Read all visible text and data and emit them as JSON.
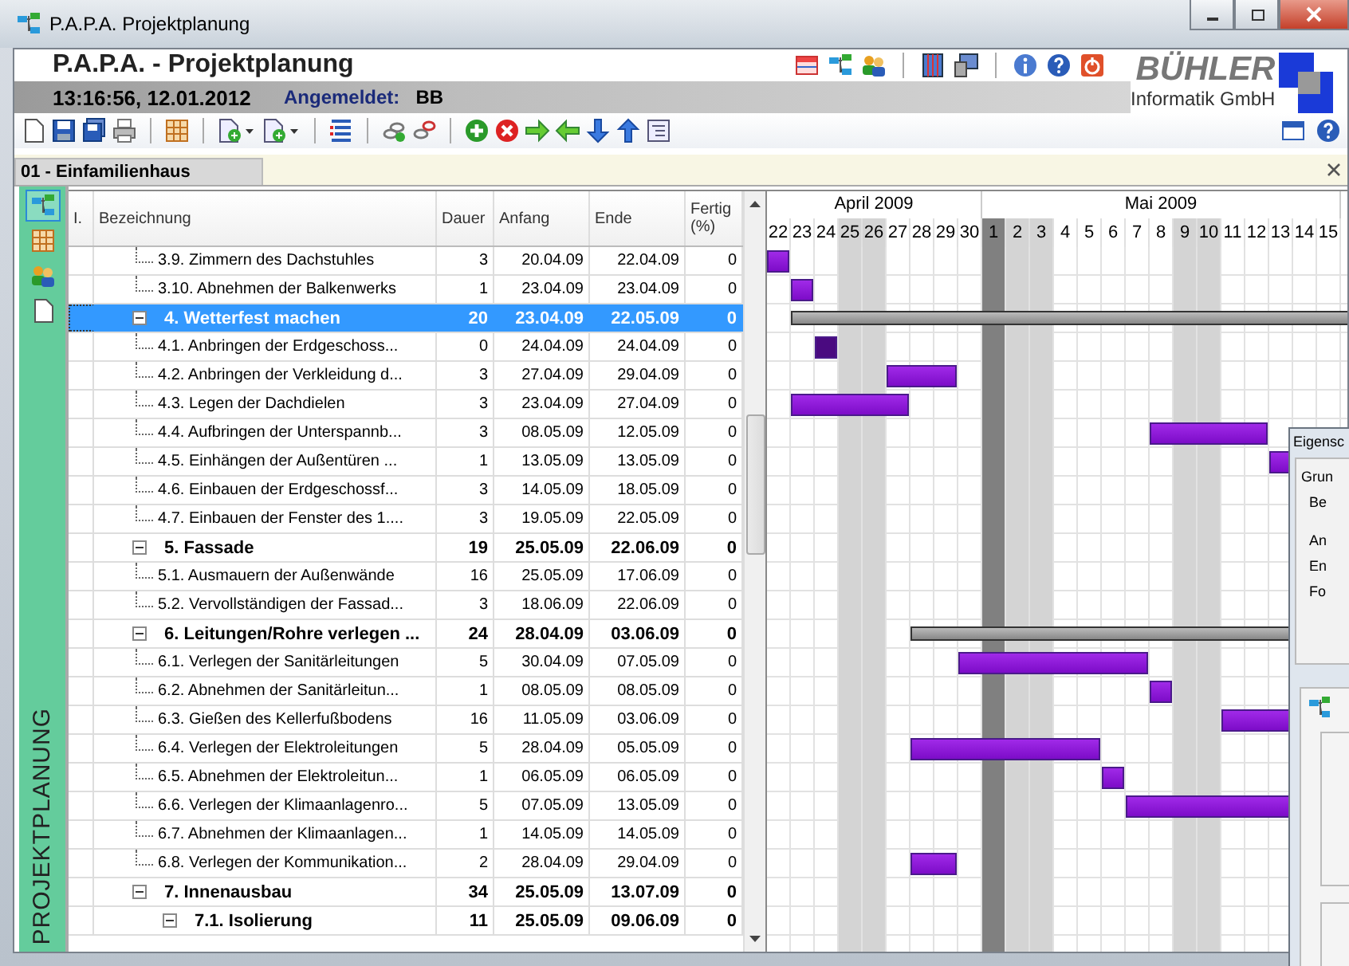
{
  "window": {
    "title": "P.A.P.A. Projektplanung"
  },
  "header": {
    "title": "P.A.P.A. - Projektplanung",
    "time": "13:16:56, 12.01.2012",
    "user_label": "Angemeldet:",
    "user": "BB",
    "logo_name": "BÜHLER",
    "logo_company": "Informatik GmbH"
  },
  "document_tab": {
    "label": "01 - Einfamilienhaus",
    "selected": true
  },
  "sidebar": {
    "label": "PROJEKTPLANUNG",
    "items": [
      {
        "kind": "tree",
        "selected": true
      },
      {
        "kind": "table",
        "selected": false
      },
      {
        "kind": "people",
        "selected": false
      },
      {
        "kind": "page",
        "selected": false
      }
    ]
  },
  "table": {
    "columns": [
      "I.",
      "Bezeichnung",
      "Dauer",
      "Anfang",
      "Ende",
      "Fertig (%)"
    ],
    "rows": [
      {
        "kind": "continued",
        "children": [
          {
            "name": "3.9. Zimmern des Dachstuhles",
            "duration": "3",
            "start": "20.04.09",
            "end": "22.04.09",
            "done": "0",
            "selected": false
          },
          {
            "name": "3.10. Abnehmen der Balkenwerks",
            "duration": "1",
            "start": "23.04.09",
            "end": "23.04.09",
            "done": "0",
            "selected": false
          }
        ]
      },
      {
        "name": "4. Wetterfest machen",
        "duration": "20",
        "start": "23.04.09",
        "end": "22.05.09",
        "done": "0",
        "selected": true,
        "expanded": true,
        "children": [
          {
            "name": "4.1. Anbringen der Erdgeschoss...",
            "duration": "0",
            "start": "24.04.09",
            "end": "24.04.09",
            "done": "0",
            "selected": false
          },
          {
            "name": "4.2. Anbringen der Verkleidung d...",
            "duration": "3",
            "start": "27.04.09",
            "end": "29.04.09",
            "done": "0",
            "selected": false
          },
          {
            "name": "4.3. Legen der Dachdielen",
            "duration": "3",
            "start": "23.04.09",
            "end": "27.04.09",
            "done": "0",
            "selected": false
          },
          {
            "name": "4.4. Aufbringen der Unterspannb...",
            "duration": "3",
            "start": "08.05.09",
            "end": "12.05.09",
            "done": "0",
            "selected": false
          },
          {
            "name": "4.5. Einhängen der Außentüren ...",
            "duration": "1",
            "start": "13.05.09",
            "end": "13.05.09",
            "done": "0",
            "selected": false
          },
          {
            "name": "4.6. Einbauen der Erdgeschossf...",
            "duration": "3",
            "start": "14.05.09",
            "end": "18.05.09",
            "done": "0",
            "selected": false
          },
          {
            "name": "4.7. Einbauen der Fenster des 1....",
            "duration": "3",
            "start": "19.05.09",
            "end": "22.05.09",
            "done": "0",
            "selected": false
          }
        ]
      },
      {
        "name": "5. Fassade",
        "duration": "19",
        "start": "25.05.09",
        "end": "22.06.09",
        "done": "0",
        "selected": false,
        "expanded": true,
        "children": [
          {
            "name": "5.1.  Ausmauern der Außenwände",
            "duration": "16",
            "start": "25.05.09",
            "end": "17.06.09",
            "done": "0",
            "selected": false
          },
          {
            "name": "5.2. Vervollständigen der Fassad...",
            "duration": "3",
            "start": "18.06.09",
            "end": "22.06.09",
            "done": "0",
            "selected": false
          }
        ]
      },
      {
        "name": "6. Leitungen/Rohre verlegen ...",
        "duration": "24",
        "start": "28.04.09",
        "end": "03.06.09",
        "done": "0",
        "selected": false,
        "expanded": true,
        "children": [
          {
            "name": "6.1. Verlegen der Sanitärleitungen",
            "duration": "5",
            "start": "30.04.09",
            "end": "07.05.09",
            "done": "0",
            "selected": false
          },
          {
            "name": "6.2. Abnehmen der Sanitärleitun...",
            "duration": "1",
            "start": "08.05.09",
            "end": "08.05.09",
            "done": "0",
            "selected": false
          },
          {
            "name": "6.3. Gießen des Kellerfußbodens",
            "duration": "16",
            "start": "11.05.09",
            "end": "03.06.09",
            "done": "0",
            "selected": false
          },
          {
            "name": "6.4. Verlegen der Elektroleitungen",
            "duration": "5",
            "start": "28.04.09",
            "end": "05.05.09",
            "done": "0",
            "selected": false
          },
          {
            "name": "6.5. Abnehmen der Elektroleitun...",
            "duration": "1",
            "start": "06.05.09",
            "end": "06.05.09",
            "done": "0",
            "selected": false
          },
          {
            "name": "6.6. Verlegen der Klimaanlagenro...",
            "duration": "5",
            "start": "07.05.09",
            "end": "13.05.09",
            "done": "0",
            "selected": false
          },
          {
            "name": "6.7. Abnehmen der Klimaanlagen...",
            "duration": "1",
            "start": "14.05.09",
            "end": "14.05.09",
            "done": "0",
            "selected": false
          },
          {
            "name": "6.8. Verlegen der Kommunikation...",
            "duration": "2",
            "start": "28.04.09",
            "end": "29.04.09",
            "done": "0",
            "selected": false
          }
        ]
      },
      {
        "name": "7. Innenausbau",
        "duration": "34",
        "start": "25.05.09",
        "end": "13.07.09",
        "done": "0",
        "selected": false,
        "expanded": true,
        "children": [
          {
            "name": "7.1. Isolierung",
            "duration": "11",
            "start": "25.05.09",
            "end": "09.06.09",
            "done": "0",
            "selected": false,
            "expanded": true
          }
        ]
      }
    ]
  },
  "gantt": {
    "months": [
      {
        "label": "April 2009",
        "days": [
          {
            "day": "22",
            "kind": "workday"
          },
          {
            "day": "23",
            "kind": "workday"
          },
          {
            "day": "24",
            "kind": "workday"
          },
          {
            "day": "25",
            "kind": "weekend"
          },
          {
            "day": "26",
            "kind": "weekend"
          },
          {
            "day": "27",
            "kind": "workday"
          },
          {
            "day": "28",
            "kind": "workday"
          },
          {
            "day": "29",
            "kind": "workday"
          },
          {
            "day": "30",
            "kind": "workday"
          }
        ]
      },
      {
        "label": "Mai 2009",
        "days": [
          {
            "day": "1",
            "kind": "holiday"
          },
          {
            "day": "2",
            "kind": "weekend"
          },
          {
            "day": "3",
            "kind": "weekend"
          },
          {
            "day": "4",
            "kind": "workday"
          },
          {
            "day": "5",
            "kind": "workday"
          },
          {
            "day": "6",
            "kind": "workday"
          },
          {
            "day": "7",
            "kind": "workday"
          },
          {
            "day": "8",
            "kind": "workday"
          },
          {
            "day": "9",
            "kind": "weekend"
          },
          {
            "day": "10",
            "kind": "weekend"
          },
          {
            "day": "11",
            "kind": "workday"
          },
          {
            "day": "12",
            "kind": "workday"
          },
          {
            "day": "13",
            "kind": "workday"
          },
          {
            "day": "14",
            "kind": "workday"
          },
          {
            "day": "15",
            "kind": "workday"
          }
        ]
      }
    ]
  },
  "overlay_dialog": {
    "title": "Eigensc",
    "group_label": "Grun",
    "labels": [
      "Be",
      "An",
      "En",
      "Fo"
    ]
  }
}
